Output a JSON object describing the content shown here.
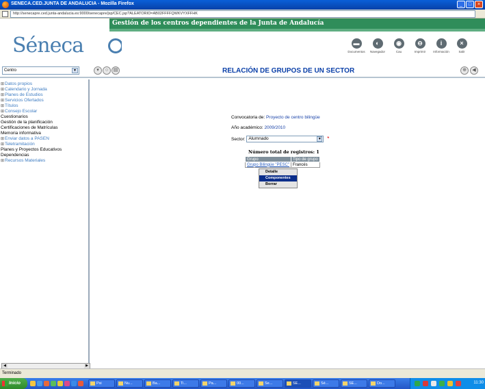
{
  "window": {
    "title": "SENECA.CED.JUNTA DE ANDALUCIA - Mozilla Firefox",
    "minimize": "_",
    "maximize": "□",
    "close": "×"
  },
  "address": {
    "url": "http://senecapre.ced.junta-andalucia.es:9000/senecapre/jsp/CEC.jsp?ALEATORIO=AB02FFFFQWKVYXFFHK"
  },
  "header": {
    "banner": "Gestión de los centros dependientes de la Junta de Andalucía",
    "logo": "Séneca",
    "toolbar": [
      {
        "label": "Documentos",
        "icon": "documents-icon",
        "glyph": "▬"
      },
      {
        "label": "Navegador",
        "icon": "browser-icon",
        "glyph": "◐"
      },
      {
        "label": "Cau",
        "icon": "help-desk-icon",
        "glyph": "◉"
      },
      {
        "label": "Imprimir",
        "icon": "print-icon",
        "glyph": "⊖"
      },
      {
        "label": "Información",
        "icon": "info-icon",
        "glyph": "i"
      },
      {
        "label": "Salir",
        "icon": "exit-icon",
        "glyph": "×"
      }
    ]
  },
  "nav": {
    "centro_label": "Centro",
    "page_title": "RELACIÓN DE GRUPOS DE UN SECTOR"
  },
  "sidebar": {
    "items": [
      {
        "label": "Datos propios",
        "folder": true
      },
      {
        "label": "Calendario y Jornada",
        "folder": true
      },
      {
        "label": "Planes de Estudios",
        "folder": true
      },
      {
        "label": "Servicios Ofertados",
        "folder": true
      },
      {
        "label": "Títulos",
        "folder": true
      },
      {
        "label": "Consejo Escolar",
        "folder": true
      },
      {
        "label": "Cuestionarios",
        "folder": false
      },
      {
        "label": "Gestión de la planificación",
        "folder": false
      },
      {
        "label": "Certificaciones de Matrículas",
        "folder": false
      },
      {
        "label": "Memoria informativa",
        "folder": false
      },
      {
        "label": "Enviar datos a PASEN",
        "folder": true
      },
      {
        "label": "Teletramitación",
        "folder": true
      },
      {
        "label": "Planes y Proyectos Educativos",
        "folder": false
      },
      {
        "label": "Dependencias",
        "folder": false
      },
      {
        "label": "Recursos Materiales",
        "folder": true
      }
    ],
    "expand_glyph": "⊞"
  },
  "form": {
    "convocatoria_label": "Convocatoria de:",
    "convocatoria_value": "Proyecto de centro bilingüe",
    "anio_label": "Año académico:",
    "anio_value": "2009/2010",
    "sector_label": "Sector:",
    "sector_value": "Alumnado",
    "required_mark": "*"
  },
  "results": {
    "total_label": "Número total de registros: 1",
    "columns": [
      "Grupo",
      "Tipo de grupo"
    ],
    "rows": [
      [
        "Grupo Bilingüe \"PESC\"",
        "Francés"
      ]
    ]
  },
  "context_menu": {
    "items": [
      "Detalle",
      "Componentes",
      "Borrar"
    ],
    "selected": "Componentes"
  },
  "status": {
    "text": "Terminado"
  },
  "taskbar": {
    "start": "Inicio",
    "tasks": [
      "Psi",
      "Nu...",
      "Ba...",
      "Ti...",
      "Pa...",
      "00...",
      "Se...",
      "SE...",
      "Sé...",
      "SE...",
      "Do..."
    ],
    "active_task": "SE...",
    "clock": "11:30"
  }
}
